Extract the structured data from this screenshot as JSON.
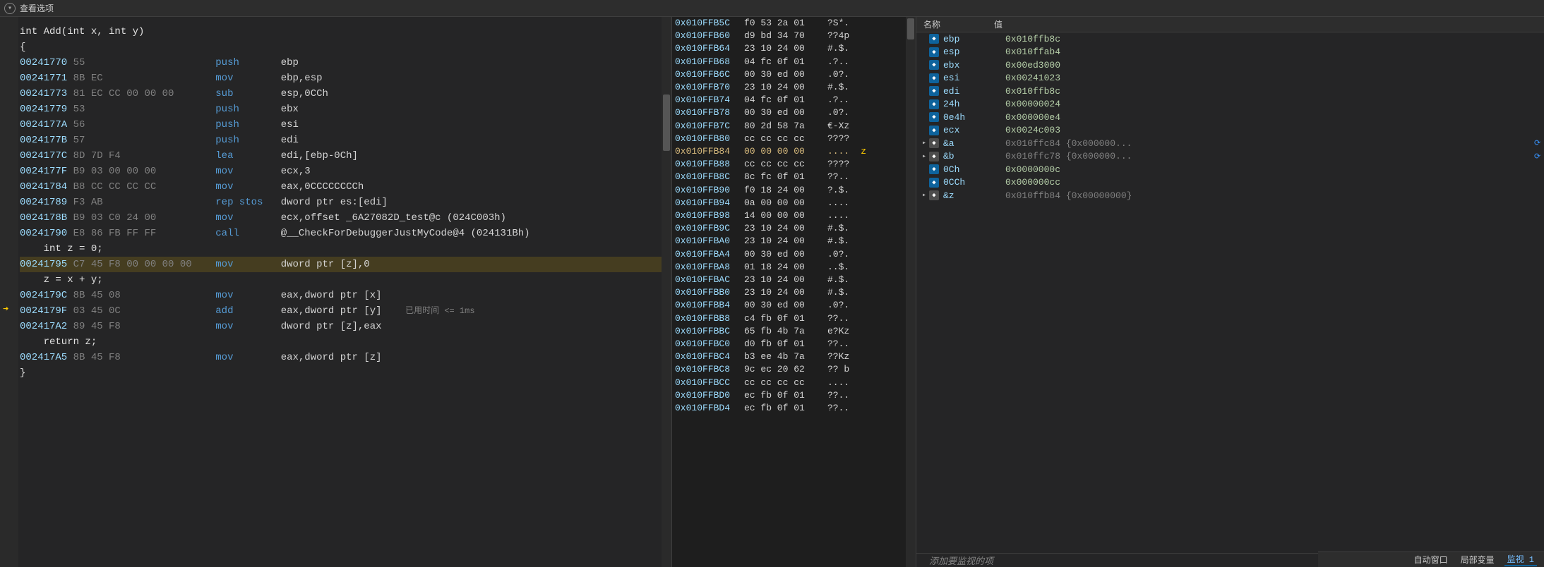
{
  "topbar": {
    "view_options": "查看选项"
  },
  "disasm": {
    "lines": [
      {
        "type": "src",
        "text": "int Add(int x, int y)"
      },
      {
        "type": "src",
        "text": "{"
      },
      {
        "type": "asm",
        "addr": "00241770",
        "bytes": "55",
        "mn": "push",
        "op": "ebp"
      },
      {
        "type": "asm",
        "addr": "00241771",
        "bytes": "8B EC",
        "mn": "mov",
        "op": "ebp,esp"
      },
      {
        "type": "asm",
        "addr": "00241773",
        "bytes": "81 EC CC 00 00 00",
        "mn": "sub",
        "op": "esp,0CCh"
      },
      {
        "type": "asm",
        "addr": "00241779",
        "bytes": "53",
        "mn": "push",
        "op": "ebx"
      },
      {
        "type": "asm",
        "addr": "0024177A",
        "bytes": "56",
        "mn": "push",
        "op": "esi"
      },
      {
        "type": "asm",
        "addr": "0024177B",
        "bytes": "57",
        "mn": "push",
        "op": "edi"
      },
      {
        "type": "asm",
        "addr": "0024177C",
        "bytes": "8D 7D F4",
        "mn": "lea",
        "op": "edi,[ebp-0Ch]"
      },
      {
        "type": "asm",
        "addr": "0024177F",
        "bytes": "B9 03 00 00 00",
        "mn": "mov",
        "op": "ecx,3"
      },
      {
        "type": "asm",
        "addr": "00241784",
        "bytes": "B8 CC CC CC CC",
        "mn": "mov",
        "op": "eax,0CCCCCCCCh"
      },
      {
        "type": "asm",
        "addr": "00241789",
        "bytes": "F3 AB",
        "mn": "rep stos",
        "op": "dword ptr es:[edi]"
      },
      {
        "type": "asm",
        "addr": "0024178B",
        "bytes": "B9 03 C0 24 00",
        "mn": "mov",
        "op": "ecx,offset _6A27082D_test@c (024C003h)"
      },
      {
        "type": "asm",
        "addr": "00241790",
        "bytes": "E8 86 FB FF FF",
        "mn": "call",
        "op": "@__CheckForDebuggerJustMyCode@4 (024131Bh)"
      },
      {
        "type": "src",
        "text": "    int z = 0;"
      },
      {
        "type": "asm",
        "addr": "00241795",
        "bytes": "C7 45 F8 00 00 00 00",
        "mn": "mov",
        "op": "dword ptr [z],0",
        "hl": true
      },
      {
        "type": "src",
        "text": "    z = x + y;"
      },
      {
        "type": "asm",
        "addr": "0024179C",
        "bytes": "8B 45 08",
        "mn": "mov",
        "op": "eax,dword ptr [x]"
      },
      {
        "type": "asm",
        "addr": "0024179F",
        "bytes": "03 45 0C",
        "mn": "add",
        "op": "eax,dword ptr [y]",
        "current": true,
        "timing": "已用时间 <= 1ms"
      },
      {
        "type": "asm",
        "addr": "002417A2",
        "bytes": "89 45 F8",
        "mn": "mov",
        "op": "dword ptr [z],eax"
      },
      {
        "type": "src",
        "text": "    return z;"
      },
      {
        "type": "asm",
        "addr": "002417A5",
        "bytes": "8B 45 F8",
        "mn": "mov",
        "op": "eax,dword ptr [z]"
      },
      {
        "type": "src",
        "text": "}"
      }
    ]
  },
  "memory": {
    "rows": [
      {
        "addr": "0x010FFB5C",
        "bytes": "f0 53 2a 01",
        "ascii": "?S*."
      },
      {
        "addr": "0x010FFB60",
        "bytes": "d9 bd 34 70",
        "ascii": "??4p"
      },
      {
        "addr": "0x010FFB64",
        "bytes": "23 10 24 00",
        "ascii": "#.$."
      },
      {
        "addr": "0x010FFB68",
        "bytes": "04 fc 0f 01",
        "ascii": ".?.."
      },
      {
        "addr": "0x010FFB6C",
        "bytes": "00 30 ed 00",
        "ascii": ".0?."
      },
      {
        "addr": "0x010FFB70",
        "bytes": "23 10 24 00",
        "ascii": "#.$."
      },
      {
        "addr": "0x010FFB74",
        "bytes": "04 fc 0f 01",
        "ascii": ".?.."
      },
      {
        "addr": "0x010FFB78",
        "bytes": "00 30 ed 00",
        "ascii": ".0?."
      },
      {
        "addr": "0x010FFB7C",
        "bytes": "80 2d 58 7a",
        "ascii": "€-Xz"
      },
      {
        "addr": "0x010FFB80",
        "bytes": "cc cc cc cc",
        "ascii": "????"
      },
      {
        "addr": "0x010FFB84",
        "bytes": "00 00 00 00",
        "ascii": "....",
        "hl": true,
        "annot": "z"
      },
      {
        "addr": "0x010FFB88",
        "bytes": "cc cc cc cc",
        "ascii": "????"
      },
      {
        "addr": "0x010FFB8C",
        "bytes": "8c fc 0f 01",
        "ascii": "??.."
      },
      {
        "addr": "0x010FFB90",
        "bytes": "f0 18 24 00",
        "ascii": "?.$."
      },
      {
        "addr": "0x010FFB94",
        "bytes": "0a 00 00 00",
        "ascii": "...."
      },
      {
        "addr": "0x010FFB98",
        "bytes": "14 00 00 00",
        "ascii": "...."
      },
      {
        "addr": "0x010FFB9C",
        "bytes": "23 10 24 00",
        "ascii": "#.$."
      },
      {
        "addr": "0x010FFBA0",
        "bytes": "23 10 24 00",
        "ascii": "#.$."
      },
      {
        "addr": "0x010FFBA4",
        "bytes": "00 30 ed 00",
        "ascii": ".0?."
      },
      {
        "addr": "0x010FFBA8",
        "bytes": "01 18 24 00",
        "ascii": "..$."
      },
      {
        "addr": "0x010FFBAC",
        "bytes": "23 10 24 00",
        "ascii": "#.$."
      },
      {
        "addr": "0x010FFBB0",
        "bytes": "23 10 24 00",
        "ascii": "#.$."
      },
      {
        "addr": "0x010FFBB4",
        "bytes": "00 30 ed 00",
        "ascii": ".0?."
      },
      {
        "addr": "0x010FFBB8",
        "bytes": "c4 fb 0f 01",
        "ascii": "??.."
      },
      {
        "addr": "0x010FFBBC",
        "bytes": "65 fb 4b 7a",
        "ascii": "e?Kz"
      },
      {
        "addr": "0x010FFBC0",
        "bytes": "d0 fb 0f 01",
        "ascii": "??.."
      },
      {
        "addr": "0x010FFBC4",
        "bytes": "b3 ee 4b 7a",
        "ascii": "??Kz"
      },
      {
        "addr": "0x010FFBC8",
        "bytes": "9c ec 20 62",
        "ascii": "?? b"
      },
      {
        "addr": "0x010FFBCC",
        "bytes": "cc cc cc cc",
        "ascii": "...."
      },
      {
        "addr": "0x010FFBD0",
        "bytes": "ec fb 0f 01",
        "ascii": "??.."
      },
      {
        "addr": "0x010FFBD4",
        "bytes": "ec fb 0f 01",
        "ascii": "??.."
      }
    ]
  },
  "watch": {
    "header": {
      "name": "名称",
      "value": "值"
    },
    "rows": [
      {
        "expand": "",
        "icon": "blue",
        "name": "ebp",
        "value": "0x010ffb8c"
      },
      {
        "expand": "",
        "icon": "blue",
        "name": "esp",
        "value": "0x010ffab4"
      },
      {
        "expand": "",
        "icon": "blue",
        "name": "ebx",
        "value": "0x00ed3000"
      },
      {
        "expand": "",
        "icon": "blue",
        "name": "esi",
        "value": "0x00241023"
      },
      {
        "expand": "",
        "icon": "blue",
        "name": "edi",
        "value": "0x010ffb8c"
      },
      {
        "expand": "",
        "icon": "blue",
        "name": "24h",
        "value": "0x00000024"
      },
      {
        "expand": "",
        "icon": "blue",
        "name": "0e4h",
        "value": "0x000000e4"
      },
      {
        "expand": "",
        "icon": "blue",
        "name": "ecx",
        "value": "0x0024c003"
      },
      {
        "expand": "▸",
        "icon": "gray",
        "name": "&a",
        "value": "0x010ffc84 {0x000000...",
        "complex": true,
        "refresh": true
      },
      {
        "expand": "▸",
        "icon": "gray",
        "name": "&b",
        "value": "0x010ffc78 {0x000000...",
        "complex": true,
        "refresh": true
      },
      {
        "expand": "",
        "icon": "blue",
        "name": "0Ch",
        "value": "0x0000000c"
      },
      {
        "expand": "",
        "icon": "blue",
        "name": "0CCh",
        "value": "0x000000cc"
      },
      {
        "expand": "▸",
        "icon": "gray",
        "name": "&z",
        "value": "0x010ffb84 {0x00000000}",
        "complex": true
      }
    ],
    "add_placeholder": "添加要监视的项"
  },
  "status": {
    "tabs": [
      {
        "label": "自动窗口",
        "active": false
      },
      {
        "label": "局部变量",
        "active": false
      },
      {
        "label": "监视 1",
        "active": true
      }
    ]
  }
}
